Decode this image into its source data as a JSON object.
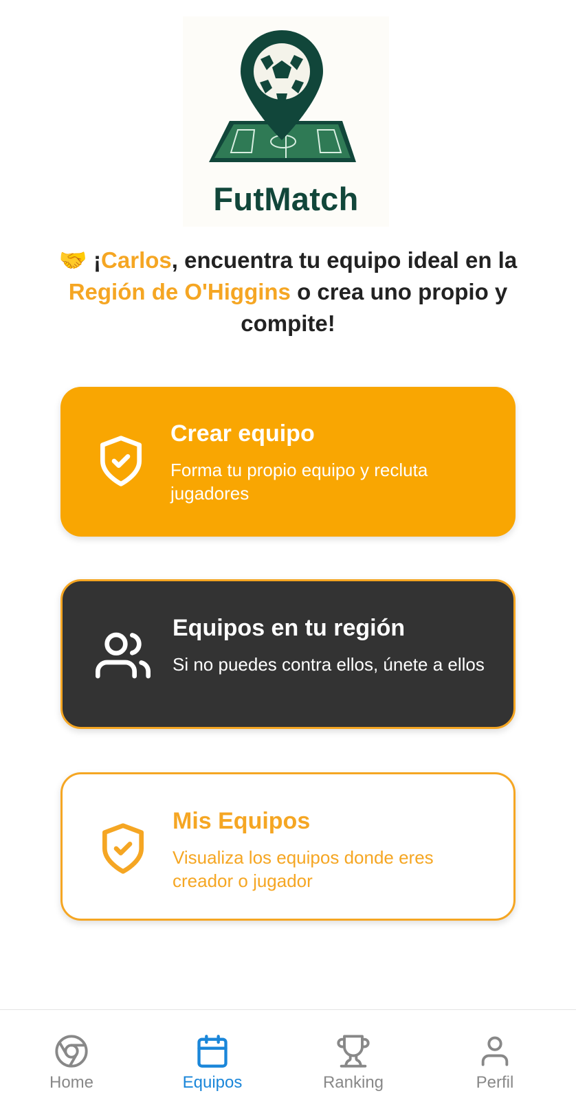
{
  "logo": {
    "brand_name": "FutMatch",
    "icon": "soccer-ball-map-pin-icon"
  },
  "greeting": {
    "emoji": "🤝",
    "part1": "¡",
    "user_name": "Carlos",
    "part2": ", encuentra tu equipo ideal en la ",
    "region": "Región de O'Higgins",
    "part3": " o crea uno propio y compite!"
  },
  "cards": [
    {
      "title": "Crear equipo",
      "description": "Forma tu propio equipo y recluta jugadores",
      "icon": "shield-check-icon"
    },
    {
      "title": "Equipos en tu región",
      "description": "Si no puedes contra ellos, únete a ellos",
      "icon": "users-icon"
    },
    {
      "title": "Mis Equipos",
      "description": "Visualiza los equipos donde eres creador o jugador",
      "icon": "shield-check-icon"
    }
  ],
  "nav": {
    "active": "Equipos",
    "items": [
      {
        "label": "Home",
        "icon": "chrome-icon"
      },
      {
        "label": "Equipos",
        "icon": "calendar-icon"
      },
      {
        "label": "Ranking",
        "icon": "trophy-icon"
      },
      {
        "label": "Perfil",
        "icon": "user-icon"
      }
    ]
  },
  "colors": {
    "accent": "#f5a623",
    "card_dark": "#333333",
    "brand_green": "#11463a",
    "nav_active": "#1a86d9",
    "nav_inactive": "#888888"
  }
}
